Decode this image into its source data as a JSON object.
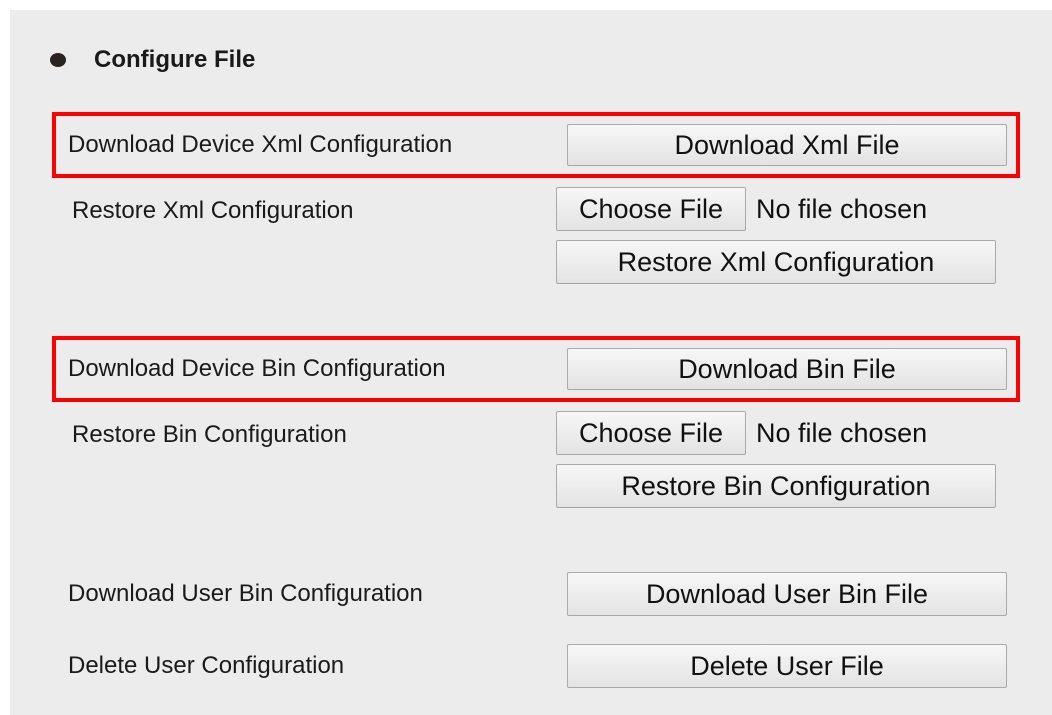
{
  "section": {
    "title": "Configure File"
  },
  "xml": {
    "download_label": "Download Device Xml Configuration",
    "download_button": "Download Xml File",
    "restore_label": "Restore Xml Configuration",
    "choose_button": "Choose File",
    "file_status": "No file chosen",
    "restore_button": "Restore Xml Configuration"
  },
  "bin": {
    "download_label": "Download Device Bin Configuration",
    "download_button": "Download Bin File",
    "restore_label": "Restore Bin Configuration",
    "choose_button": "Choose File",
    "file_status": "No file chosen",
    "restore_button": "Restore Bin Configuration"
  },
  "user_bin": {
    "download_label": "Download User Bin Configuration",
    "download_button": "Download User Bin File"
  },
  "delete_user": {
    "label": "Delete User Configuration",
    "button": "Delete User File"
  },
  "colors": {
    "panel_background": "#ececec",
    "highlight_border": "#ff0000",
    "bullet": "#2a2320"
  }
}
